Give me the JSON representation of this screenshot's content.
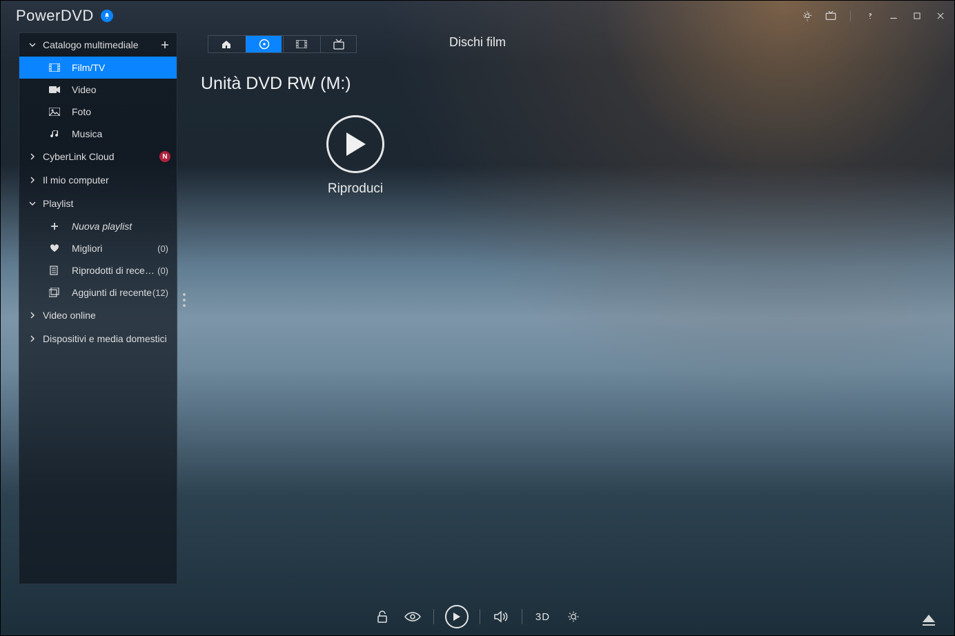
{
  "app": {
    "title": "PowerDVD"
  },
  "header": {
    "page_title": "Dischi film",
    "drive_title": "Unità DVD RW (M:)"
  },
  "play": {
    "label": "Riproduci"
  },
  "sidebar": {
    "catalog": {
      "label": "Catalogo multimediale"
    },
    "items": {
      "film_tv": "Film/TV",
      "video": "Video",
      "foto": "Foto",
      "musica": "Musica"
    },
    "cloud": {
      "label": "CyberLink Cloud",
      "badge": "N"
    },
    "my_computer": "Il mio computer",
    "playlist": {
      "label": "Playlist",
      "new": "Nuova playlist",
      "best": {
        "label": "Migliori",
        "count": "(0)"
      },
      "recent_played": {
        "label": "Riprodotti di recente",
        "count": "(0)"
      },
      "recent_added": {
        "label": "Aggiunti di recente",
        "count": "(12)"
      }
    },
    "video_online": "Video online",
    "devices": "Dispositivi e media domestici"
  },
  "bottom": {
    "three_d": "3D"
  }
}
